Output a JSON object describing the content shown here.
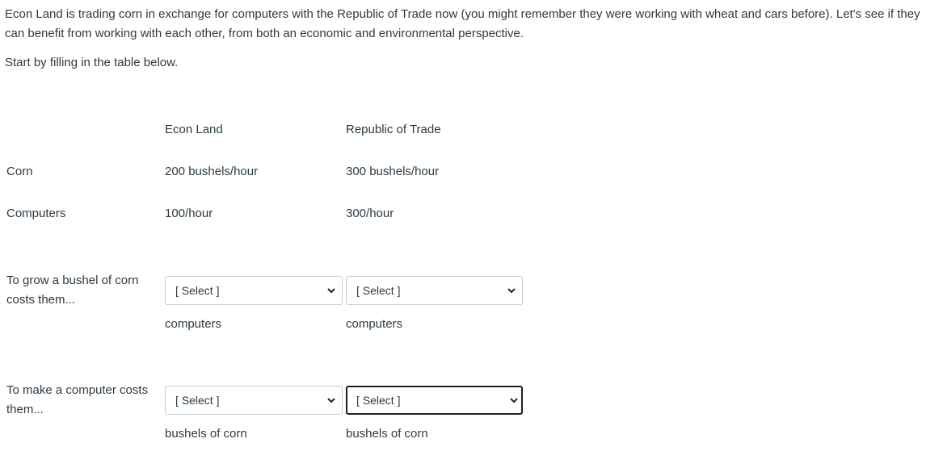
{
  "intro": {
    "paragraph": "Econ Land is trading corn in exchange for computers with the Republic of Trade now (you might remember they were working with wheat and cars before).  Let's see if they can benefit from working with each other, from both an economic and environmental perspective.",
    "instruction": "Start by filling in the table below."
  },
  "table": {
    "headers": [
      "",
      "Econ Land",
      "Republic of Trade"
    ],
    "rows": [
      {
        "label": "Corn",
        "econ_land": "200 bushels/hour",
        "republic": "300 bushels/hour"
      },
      {
        "label": "Computers",
        "econ_land": "100/hour",
        "republic": "300/hour"
      }
    ],
    "questions": [
      {
        "label_line1": "To grow a bushel of corn",
        "label_line2": "costs them...",
        "econ_select": "[ Select ]",
        "republic_select": "[ Select ]",
        "unit": "computers"
      },
      {
        "label_line1": "To make a computer costs",
        "label_line2": "them...",
        "econ_select": "[ Select ]",
        "republic_select": "[ Select ]",
        "unit": "bushels of corn"
      }
    ]
  },
  "icons": {
    "dropdown": "chevron-down-icon"
  }
}
